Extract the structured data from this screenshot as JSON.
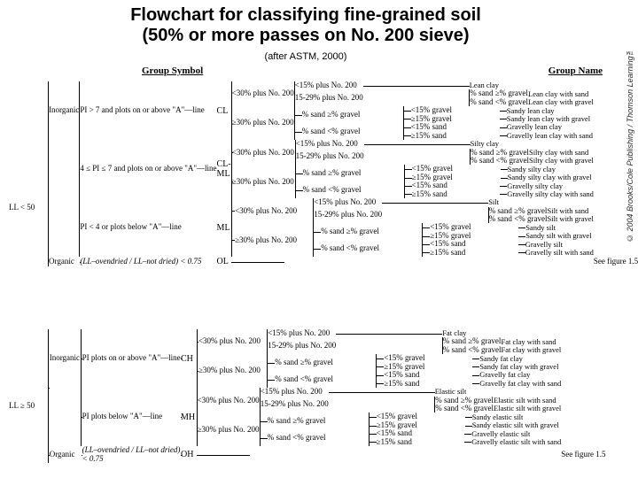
{
  "title_line1": "Flowchart for classifying fine-grained soil",
  "title_line2": "(50% or more passes on No. 200 sieve)",
  "after": "(after ASTM, 2000)",
  "copyright": "© 2004 Brooks/Cole Publishing / Thomson Learning™",
  "headers": {
    "symbol": "Group Symbol",
    "name": "Group Name"
  },
  "root": {
    "lt50": "LL < 50",
    "ge50": "LL ≥ 50"
  },
  "inorg": "Inorganic",
  "org": "Organic",
  "orgratio": "LL–ovendried",
  "orgratio2": "LL–not dried",
  "orglt": "< 0.75",
  "pi": {
    "cl": "PI > 7 and plots\non or above\n\"A\"—line",
    "clml": "4 ≤ PI ≤ 7 and\nplots on or above\n\"A\"—line",
    "ml": "PI < 4 or plots\nbelow \"A\"—line",
    "ch": "PI plots on or\nabove \"A\"—line",
    "mh": "PI plots below\n\"A\"—line"
  },
  "sym": {
    "cl": "CL",
    "clml": "CL-ML",
    "ml": "ML",
    "ol": "OL",
    "ch": "CH",
    "mh": "MH",
    "oh": "OH"
  },
  "p200": {
    "lt30": "<30% plus No. 200",
    "ge30": "≥30% plus No. 200"
  },
  "p200b": {
    "lt15": "<15% plus No. 200",
    "r1529": "15-29% plus No. 200",
    "sand_ge": "% sand ≥% gravel",
    "sand_lt": "% sand <% gravel"
  },
  "pct": {
    "sge": "% sand ≥% gravel",
    "slt": "% sand <% gravel",
    "glt15": "<15% gravel",
    "gge15": "≥15% gravel",
    "slt15": "<15% sand",
    "sge15": "≥15% sand"
  },
  "seefig": "See figure 1.5",
  "names": {
    "cl": [
      "Lean clay",
      "Lean clay with sand",
      "Lean clay with gravel",
      "Sandy lean clay",
      "Sandy lean clay with gravel",
      "Gravelly lean clay",
      "Gravelly lean clay with sand"
    ],
    "clml": [
      "Silty clay",
      "Silty clay with sand",
      "Silty clay with gravel",
      "Sandy silty clay",
      "Sandy silty clay with gravel",
      "Gravelly silty clay",
      "Gravelly silty clay with sand"
    ],
    "ml": [
      "Silt",
      "Silt with sand",
      "Silt with gravel",
      "Sandy silt",
      "Sandy silt with gravel",
      "Gravelly silt",
      "Gravelly silt with sand"
    ],
    "ch": [
      "Fat clay",
      "Fat clay with sand",
      "Fat clay with gravel",
      "Sandy fat clay",
      "Sandy fat clay with gravel",
      "Gravelly fat clay",
      "Gravelly fat clay with sand"
    ],
    "mh": [
      "Elastic silt",
      "Elastic silt with sand",
      "Elastic silt with gravel",
      "Sandy elastic silt",
      "Sandy elastic silt with gravel",
      "Gravelly elastic silt",
      "Gravelly elastic silt with sand"
    ]
  }
}
